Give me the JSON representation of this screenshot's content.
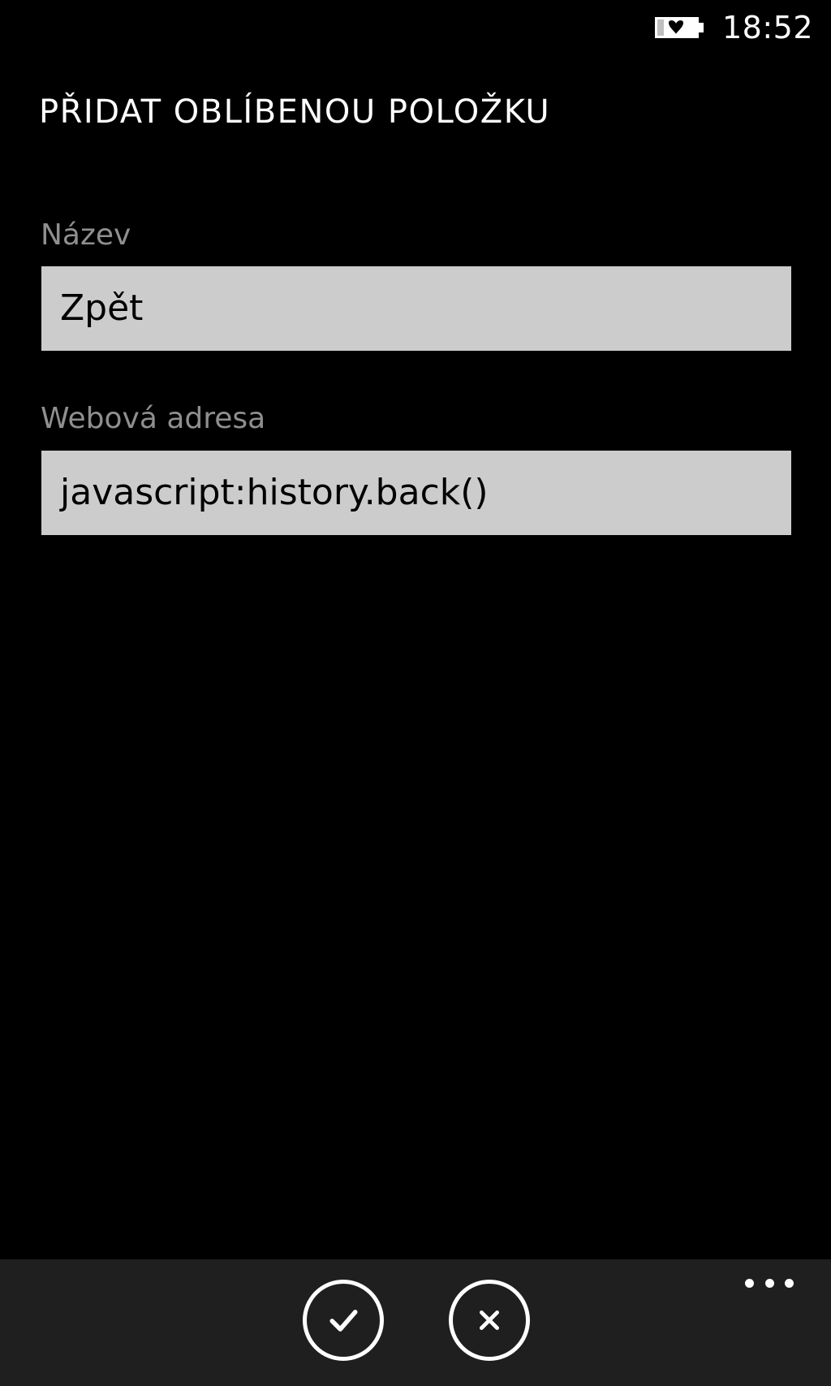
{
  "status_bar": {
    "time": "18:52",
    "battery_icon": "battery-charging-icon"
  },
  "page": {
    "title": "PŘIDAT OBLÍBENOU POLOŽKU"
  },
  "form": {
    "name_label": "Název",
    "name_value": "Zpět",
    "url_label": "Webová adresa",
    "url_value": "javascript:history.back()"
  },
  "app_bar": {
    "accept_icon": "checkmark-icon",
    "cancel_icon": "close-icon",
    "more_icon": "more-options-icon"
  },
  "colors": {
    "background": "#000000",
    "text": "#ffffff",
    "label": "#8f8f8f",
    "field_background": "#cccccc",
    "app_bar_background": "#1f1f1f"
  }
}
